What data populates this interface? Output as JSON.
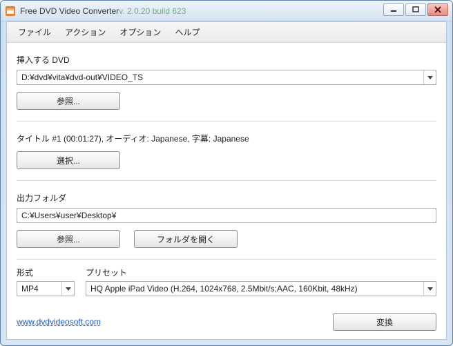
{
  "window": {
    "title_app": "Free DVD Video Converter",
    "title_version": "  v. 2.0.20 build 623"
  },
  "menu": {
    "file": "ファイル",
    "action": "アクション",
    "option": "オプション",
    "help": "ヘルプ"
  },
  "dvd": {
    "label": "挿入する DVD",
    "value": "D:¥dvd¥vita¥dvd-out¥VIDEO_TS",
    "browse": "参照..."
  },
  "title_info": {
    "text": "タイトル #1 (00:01:27), オーディオ: Japanese, 字幕: Japanese",
    "select": "選択..."
  },
  "output": {
    "label": "出力フォルダ",
    "value": "C:¥Users¥user¥Desktop¥",
    "browse": "参照...",
    "open": "フォルダを開く"
  },
  "format": {
    "label": "形式",
    "value": "MP4"
  },
  "preset": {
    "label": "プリセット",
    "value": "HQ Apple iPad Video (H.264, 1024x768, 2.5Mbit/s;AAC, 160Kbit, 48kHz)"
  },
  "footer": {
    "link": "www.dvdvideosoft.com",
    "convert": "変換"
  }
}
